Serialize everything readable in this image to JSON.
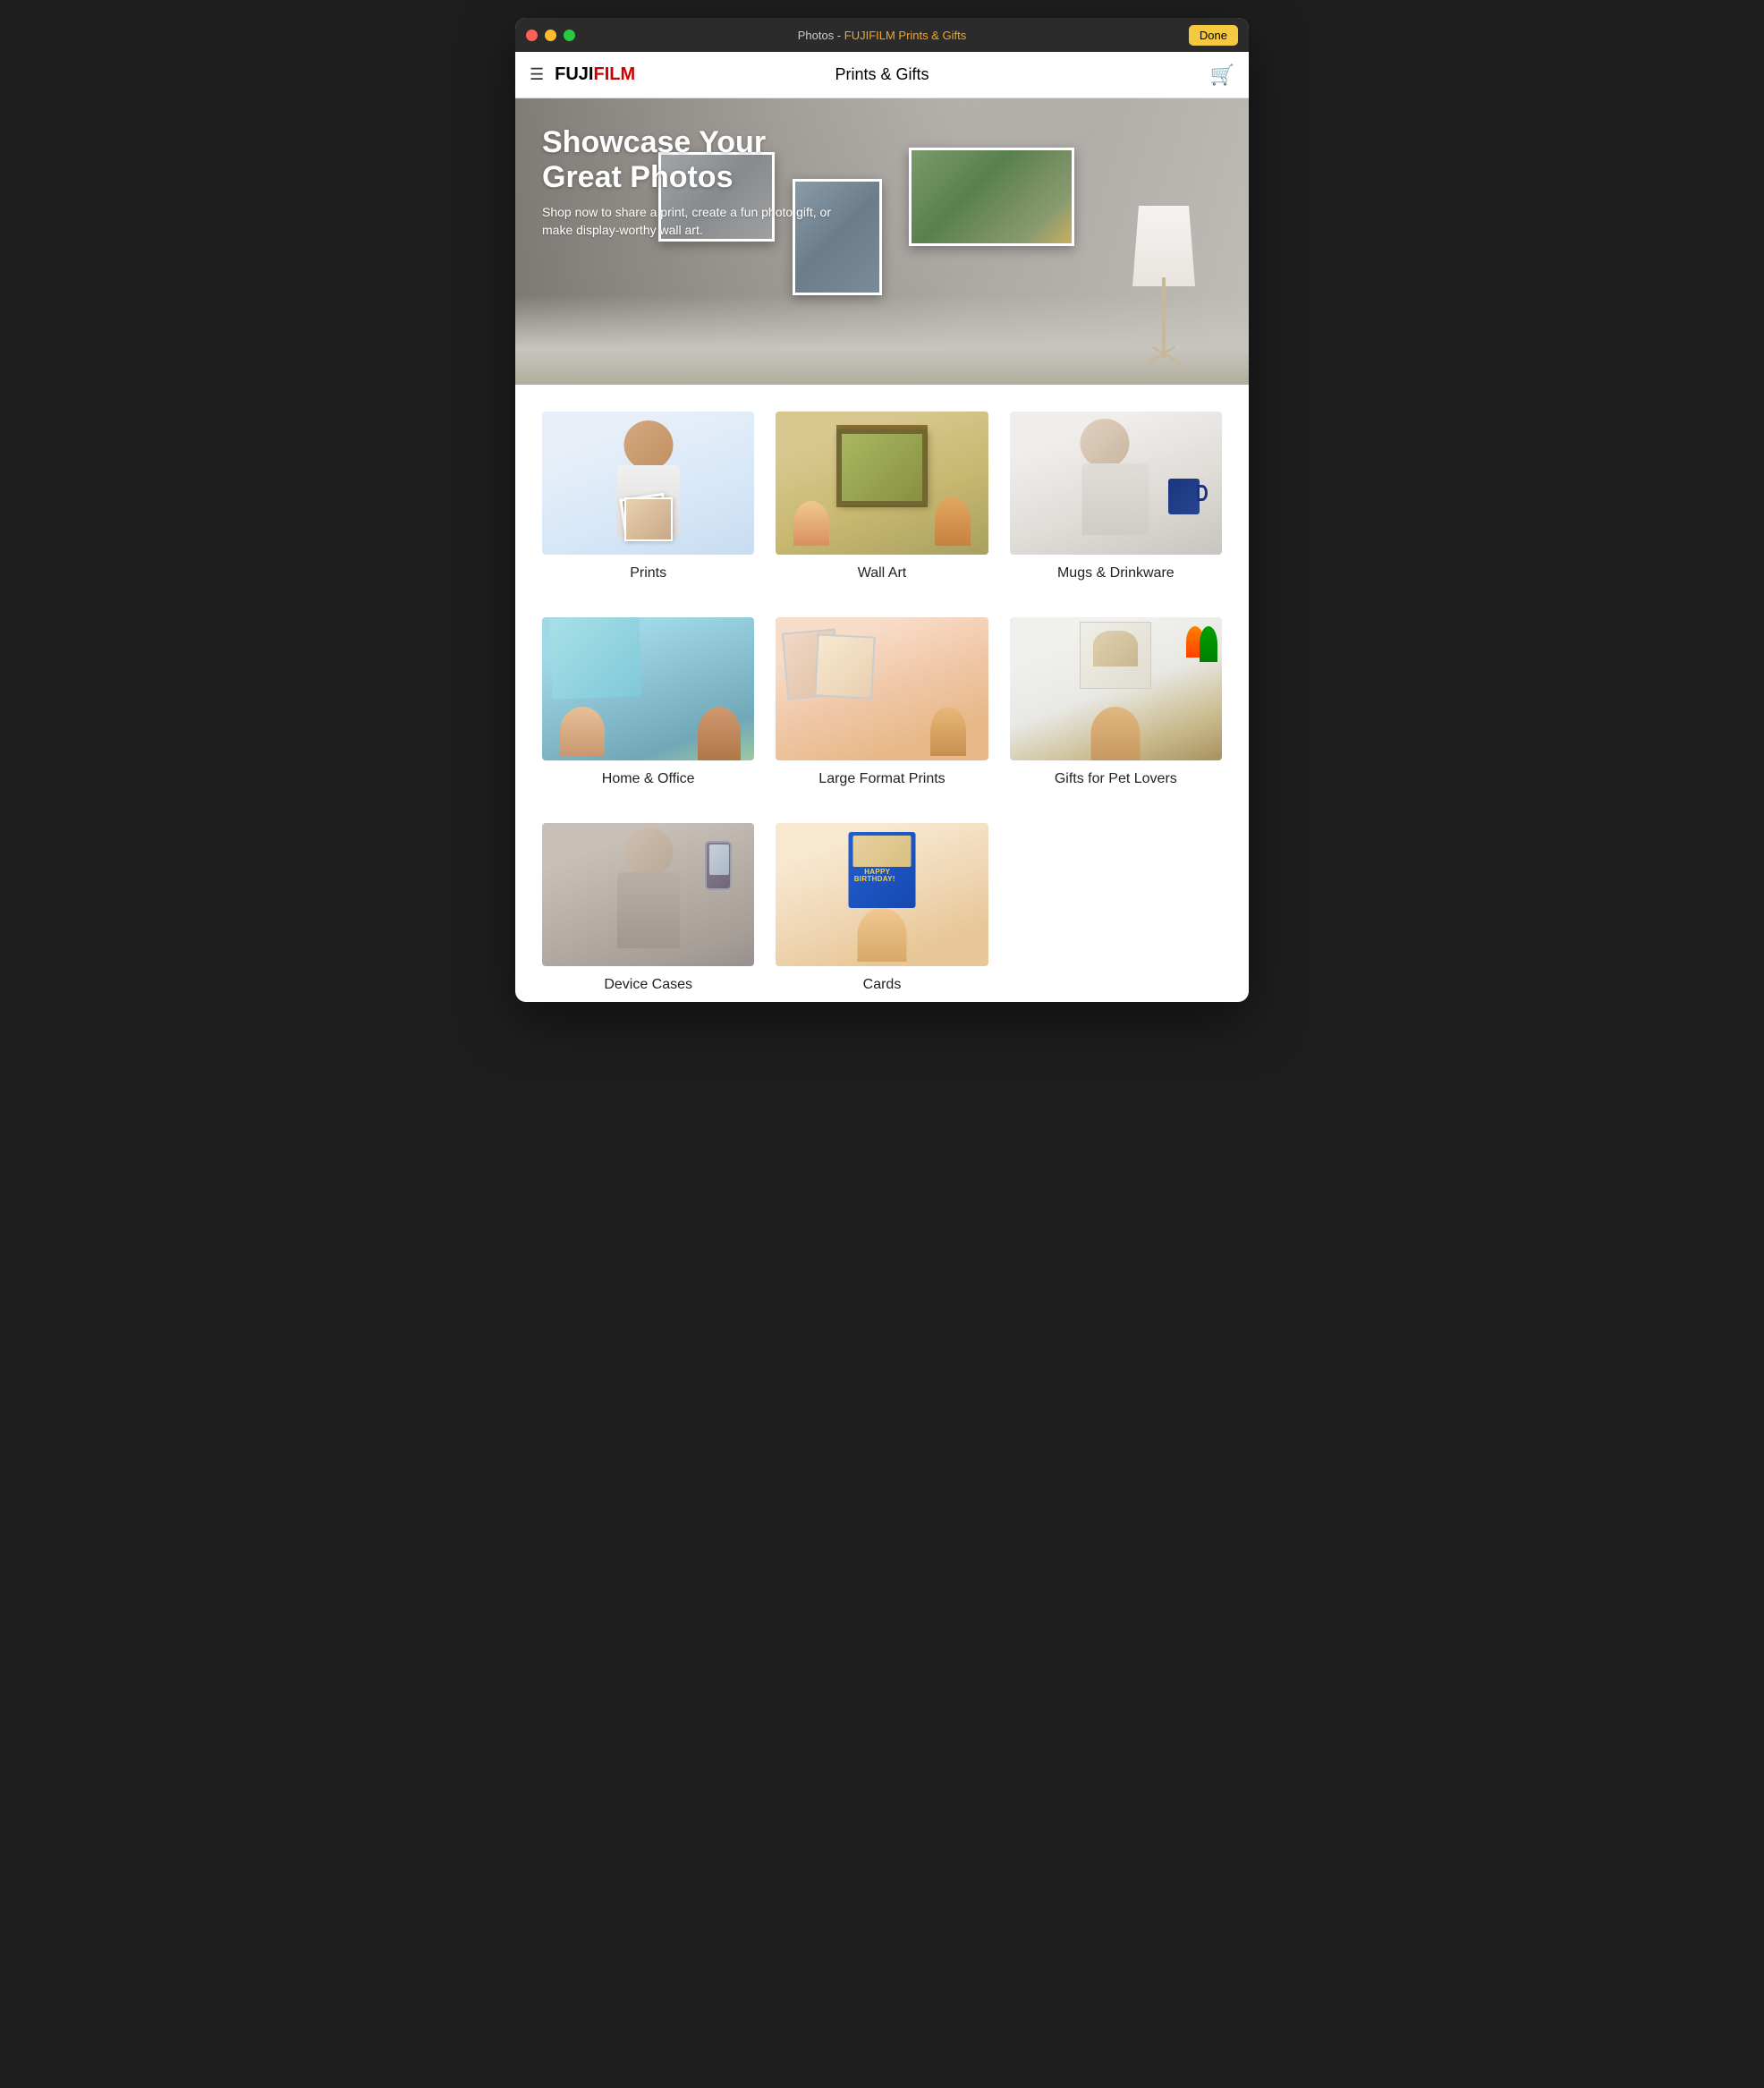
{
  "window": {
    "title_prefix": "Photos - ",
    "title_brand": "FUJIFILM Prints & Gifts",
    "done_button": "Done"
  },
  "nav": {
    "logo": "FUJIFILM",
    "title": "Prints & Gifts"
  },
  "hero": {
    "title": "Showcase Your Great Photos",
    "subtitle": "Shop now to share a print, create a fun photo gift, or make display-worthy wall art."
  },
  "categories": [
    {
      "id": "prints",
      "label": "Prints"
    },
    {
      "id": "wallart",
      "label": "Wall Art"
    },
    {
      "id": "mugs",
      "label": "Mugs & Drinkware"
    },
    {
      "id": "homeoffice",
      "label": "Home & Office"
    },
    {
      "id": "largeformat",
      "label": "Large Format Prints"
    },
    {
      "id": "petlovers",
      "label": "Gifts for Pet Lovers"
    },
    {
      "id": "devicecases",
      "label": "Device Cases"
    },
    {
      "id": "cards",
      "label": "Cards"
    }
  ]
}
